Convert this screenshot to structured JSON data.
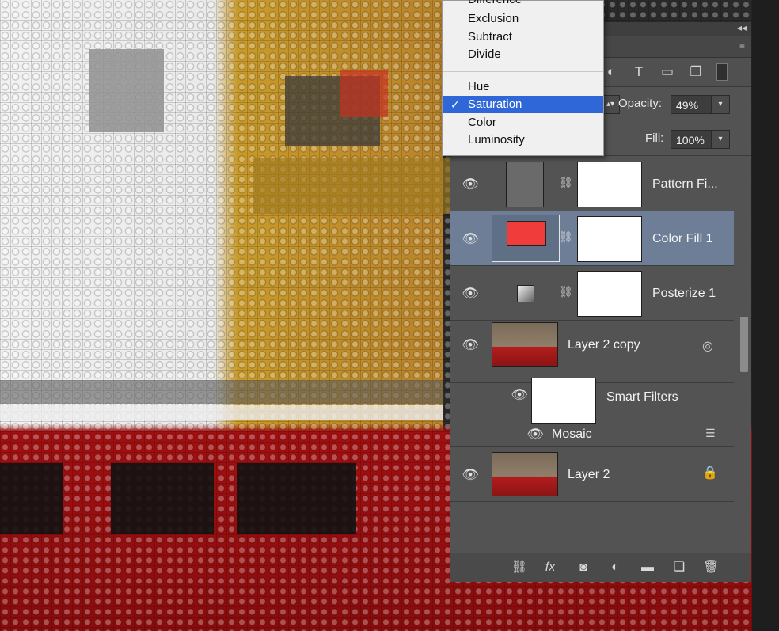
{
  "blend_menu": {
    "group1": [
      "Difference",
      "Exclusion",
      "Subtract",
      "Divide"
    ],
    "group2": [
      "Hue",
      "Saturation",
      "Color",
      "Luminosity"
    ],
    "selected": "Saturation",
    "check_glyph": "✓"
  },
  "panel": {
    "opacity_label": "Opacity:",
    "opacity_value": "49%",
    "fill_label": "Fill:",
    "fill_value": "100%",
    "filter_icons": [
      "text-filter-icon",
      "shape-filter-icon",
      "smart-object-filter-icon"
    ],
    "layers": [
      {
        "name": "Pattern Fi...",
        "thumb": "pattern-fill-thumb",
        "has_mask": true
      },
      {
        "name": "Color Fill 1",
        "thumb": "color-fill-thumb",
        "has_mask": true,
        "selected": true,
        "color": "#f13c3c"
      },
      {
        "name": "Posterize 1",
        "thumb": "posterize-icon",
        "has_mask": true
      },
      {
        "name": "Layer 2 copy",
        "thumb": "photo-thumb",
        "smart_object": true
      },
      {
        "name": "Smart Filters",
        "thumb": "filter-mask-thumb"
      },
      {
        "name": "Mosaic",
        "thumb": "none"
      },
      {
        "name": "Layer 2",
        "thumb": "photo-thumb",
        "locked": true
      }
    ],
    "bottom_icons": [
      "link-icon",
      "fx-icon",
      "mask-icon",
      "adjustment-icon",
      "folder-icon",
      "new-layer-icon",
      "trash-icon"
    ]
  },
  "colors": {
    "selection_blue": "#2f66d8",
    "selected_layer": "#6f7e97",
    "panel_bg": "#535353",
    "fill_red": "#f13c3c"
  }
}
